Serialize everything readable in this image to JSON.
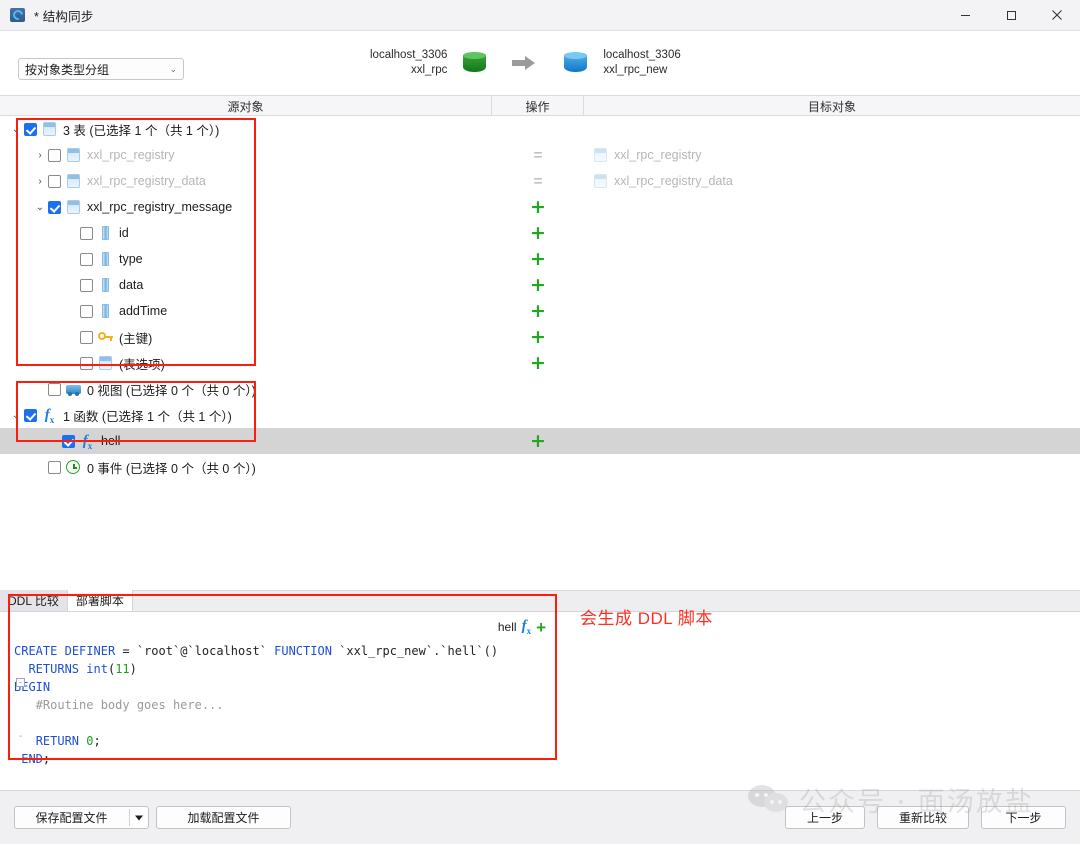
{
  "window": {
    "title": "* 结构同步",
    "icon": "structure-sync-icon",
    "minimize": "minimize-icon",
    "maximize": "maximize-icon",
    "close": "close-icon"
  },
  "toolbar": {
    "group_select_value": "按对象类型分组",
    "chevron": "⌄"
  },
  "route": {
    "source_host": "localhost_3306",
    "source_db": "xxl_rpc",
    "target_host": "localhost_3306",
    "target_db": "xxl_rpc_new",
    "source_icon": "green-database-cylinder-icon",
    "target_icon": "blue-database-cylinder-icon",
    "arrow_icon": "right-arrow-icon"
  },
  "columns": {
    "source": "源对象",
    "operation": "操作",
    "target": "目标对象"
  },
  "tree": [
    {
      "id": "tables-group",
      "indent": 8,
      "twisty": "⌄",
      "checked": true,
      "icon": "table-icon",
      "label": "3 表 (已选择 1 个（共 1 个）)",
      "dim": false,
      "op": "",
      "target": "",
      "target_icon": "",
      "selected": false
    },
    {
      "id": "xxl_rpc_registry",
      "indent": 32,
      "twisty": "›",
      "checked": false,
      "icon": "table-icon",
      "label": "xxl_rpc_registry",
      "dim": true,
      "op": "=",
      "target": "xxl_rpc_registry",
      "target_icon": "table-icon",
      "selected": false
    },
    {
      "id": "xxl_rpc_registry_data",
      "indent": 32,
      "twisty": "›",
      "checked": false,
      "icon": "table-icon",
      "label": "xxl_rpc_registry_data",
      "dim": true,
      "op": "=",
      "target": "xxl_rpc_registry_data",
      "target_icon": "table-icon",
      "selected": false
    },
    {
      "id": "xxl_rpc_registry_message",
      "indent": 32,
      "twisty": "⌄",
      "checked": true,
      "icon": "table-icon",
      "label": "xxl_rpc_registry_message",
      "dim": false,
      "op": "+",
      "target": "",
      "target_icon": "",
      "selected": false
    },
    {
      "id": "col-id",
      "indent": 64,
      "twisty": "",
      "checked": false,
      "icon": "column-icon",
      "label": "id",
      "dim": false,
      "op": "+",
      "target": "",
      "target_icon": "",
      "selected": false
    },
    {
      "id": "col-type",
      "indent": 64,
      "twisty": "",
      "checked": false,
      "icon": "column-icon",
      "label": "type",
      "dim": false,
      "op": "+",
      "target": "",
      "target_icon": "",
      "selected": false
    },
    {
      "id": "col-data",
      "indent": 64,
      "twisty": "",
      "checked": false,
      "icon": "column-icon",
      "label": "data",
      "dim": false,
      "op": "+",
      "target": "",
      "target_icon": "",
      "selected": false
    },
    {
      "id": "col-addTime",
      "indent": 64,
      "twisty": "",
      "checked": false,
      "icon": "column-icon",
      "label": "addTime",
      "dim": false,
      "op": "+",
      "target": "",
      "target_icon": "",
      "selected": false
    },
    {
      "id": "primary-key",
      "indent": 64,
      "twisty": "",
      "checked": false,
      "icon": "key-icon",
      "label": "(主键)",
      "dim": false,
      "op": "+",
      "target": "",
      "target_icon": "",
      "selected": false
    },
    {
      "id": "table-options",
      "indent": 64,
      "twisty": "",
      "checked": false,
      "icon": "table-icon",
      "label": "(表选项)",
      "dim": false,
      "op": "+",
      "target": "",
      "target_icon": "",
      "selected": false
    },
    {
      "id": "views-group",
      "indent": 32,
      "twisty": "",
      "checked": false,
      "icon": "view-icon",
      "label": "0 视图 (已选择 0 个（共 0 个）)",
      "dim": false,
      "op": "",
      "target": "",
      "target_icon": "",
      "selected": false
    },
    {
      "id": "functions-group",
      "indent": 8,
      "twisty": "⌄",
      "checked": true,
      "icon": "fx-icon",
      "label": "1 函数 (已选择 1 个（共 1 个）)",
      "dim": false,
      "op": "",
      "target": "",
      "target_icon": "",
      "selected": false
    },
    {
      "id": "function-hell",
      "indent": 46,
      "twisty": "",
      "checked": true,
      "icon": "fx-icon",
      "label": "hell",
      "dim": false,
      "op": "+",
      "target": "",
      "target_icon": "",
      "selected": true
    },
    {
      "id": "events-group",
      "indent": 32,
      "twisty": "",
      "checked": false,
      "icon": "event-icon",
      "label": "0 事件 (已选择 0 个（共 0 个）)",
      "dim": false,
      "op": "",
      "target": "",
      "target_icon": "",
      "selected": false
    }
  ],
  "ddl": {
    "tabs": [
      {
        "label": "DDL 比较",
        "active": false
      },
      {
        "label": "部署脚本",
        "active": true
      }
    ],
    "header_name": "hell",
    "header_fx_icon": "fx-icon",
    "header_plus_icon": "plus-icon",
    "code_lines": [
      "CREATE DEFINER = `root`@`localhost` FUNCTION `xxl_rpc_new`.`hell`()",
      "  RETURNS int(11)",
      "BEGIN",
      "   #Routine body goes here...",
      "",
      "   RETURN 0;",
      " END;"
    ]
  },
  "annotation": "会生成 DDL 脚本",
  "footer": {
    "save_profile": "保存配置文件",
    "load_profile": "加载配置文件",
    "prev_step": "上一步",
    "recompare": "重新比较",
    "next_step": "下一步"
  },
  "watermark": {
    "text": "公众号 · 面汤放盐",
    "icon": "wechat-bubble-icon"
  },
  "colors": {
    "accent_blue": "#1b6ff0",
    "plus_green": "#21a821",
    "annotation_red": "#fb1d0e",
    "keyword_blue": "#1f4fd8",
    "literal_green": "#1aa11a"
  }
}
